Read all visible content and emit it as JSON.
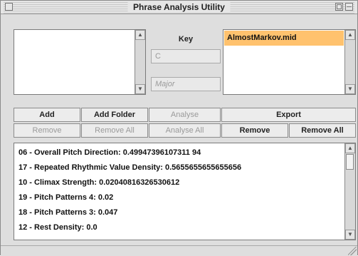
{
  "window": {
    "title": "Phrase Analysis Utility"
  },
  "key": {
    "label": "Key",
    "note_value": "C",
    "mode_value": "Major"
  },
  "files": [
    "AlmostMarkov.mid"
  ],
  "buttons": {
    "add": "Add",
    "add_folder": "Add Folder",
    "analyse": "Analyse",
    "export": "Export",
    "remove_left": "Remove",
    "remove_all_left": "Remove All",
    "analyse_all": "Analyse All",
    "remove_right": "Remove",
    "remove_all_right": "Remove All"
  },
  "results": [
    "06 - Overall Pitch Direction: 0.49947396107311 94",
    "17 - Repeated Rhythmic Value Density: 0.5655655655655656",
    "10 - Climax Strength: 0.02040816326530612",
    "19 - Pitch Patterns 4: 0.02",
    "18 - Pitch Patterns 3: 0.047",
    "12 - Rest Density: 0.0"
  ],
  "colors": {
    "selection": "#ffc26e",
    "window_bg": "#dedede"
  }
}
